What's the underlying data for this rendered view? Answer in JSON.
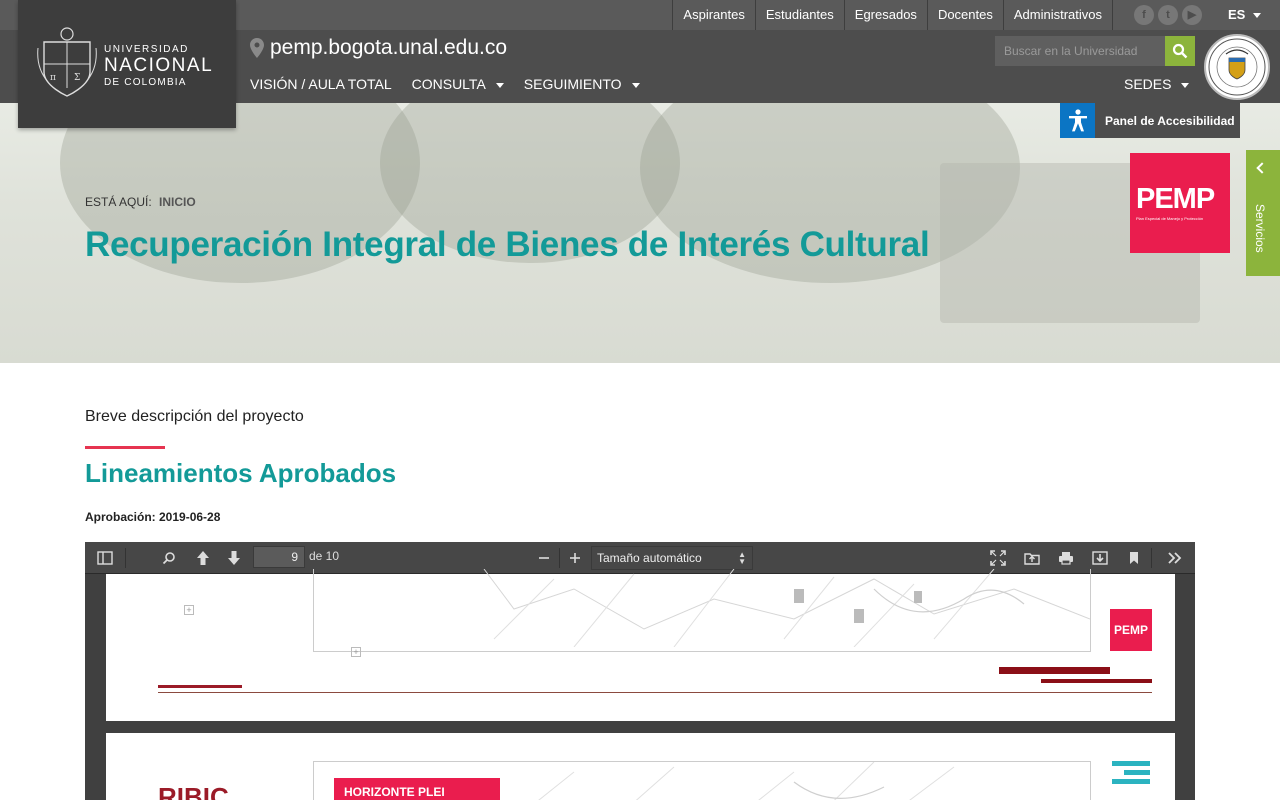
{
  "topbar": {
    "links": [
      "Aspirantes",
      "Estudiantes",
      "Egresados",
      "Docentes",
      "Administrativos"
    ],
    "social": [
      {
        "name": "facebook-icon",
        "glyph": "f"
      },
      {
        "name": "twitter-icon",
        "glyph": "t"
      },
      {
        "name": "youtube-icon",
        "glyph": "▶"
      }
    ],
    "lang": "ES"
  },
  "logo": {
    "line1": "UNIVERSIDAD",
    "line2": "NACIONAL",
    "line3": "DE COLOMBIA"
  },
  "site": {
    "domain": "pemp.bogota.unal.edu.co"
  },
  "nav": {
    "vision": "VISIÓN / AULA TOTAL",
    "consulta": "CONSULTA",
    "seguimiento": "SEGUIMIENTO",
    "sedes": "SEDES"
  },
  "search": {
    "placeholder": "Buscar en la Universidad"
  },
  "accessibility": {
    "label": "Panel de Accesibilidad"
  },
  "hero": {
    "breadcrumb_label": "ESTÁ AQUÍ:",
    "breadcrumb_current": "INICIO",
    "title": "Recuperación Integral de Bienes de Interés Cultural"
  },
  "pemp_logo": {
    "text": "PEMP",
    "subtitle": "Plan Especial de Manejo y Protección"
  },
  "services": {
    "label": "Servicios"
  },
  "content": {
    "description": "Breve descripción del proyecto",
    "heading": "Lineamientos Aprobados",
    "approval": "Aprobación: 2019-06-28"
  },
  "viewer": {
    "page_value": "9",
    "page_of": "de 10",
    "zoom": "Tamaño automático",
    "page1": {
      "logo": "PEMP"
    },
    "page2": {
      "tag": "HORIZONTE PLEI",
      "title": "RIBIC"
    }
  },
  "colors": {
    "teal": "#139a98",
    "accent_red": "#ea1d4e",
    "green": "#8cb43c",
    "dark": "#4d4d4d"
  }
}
